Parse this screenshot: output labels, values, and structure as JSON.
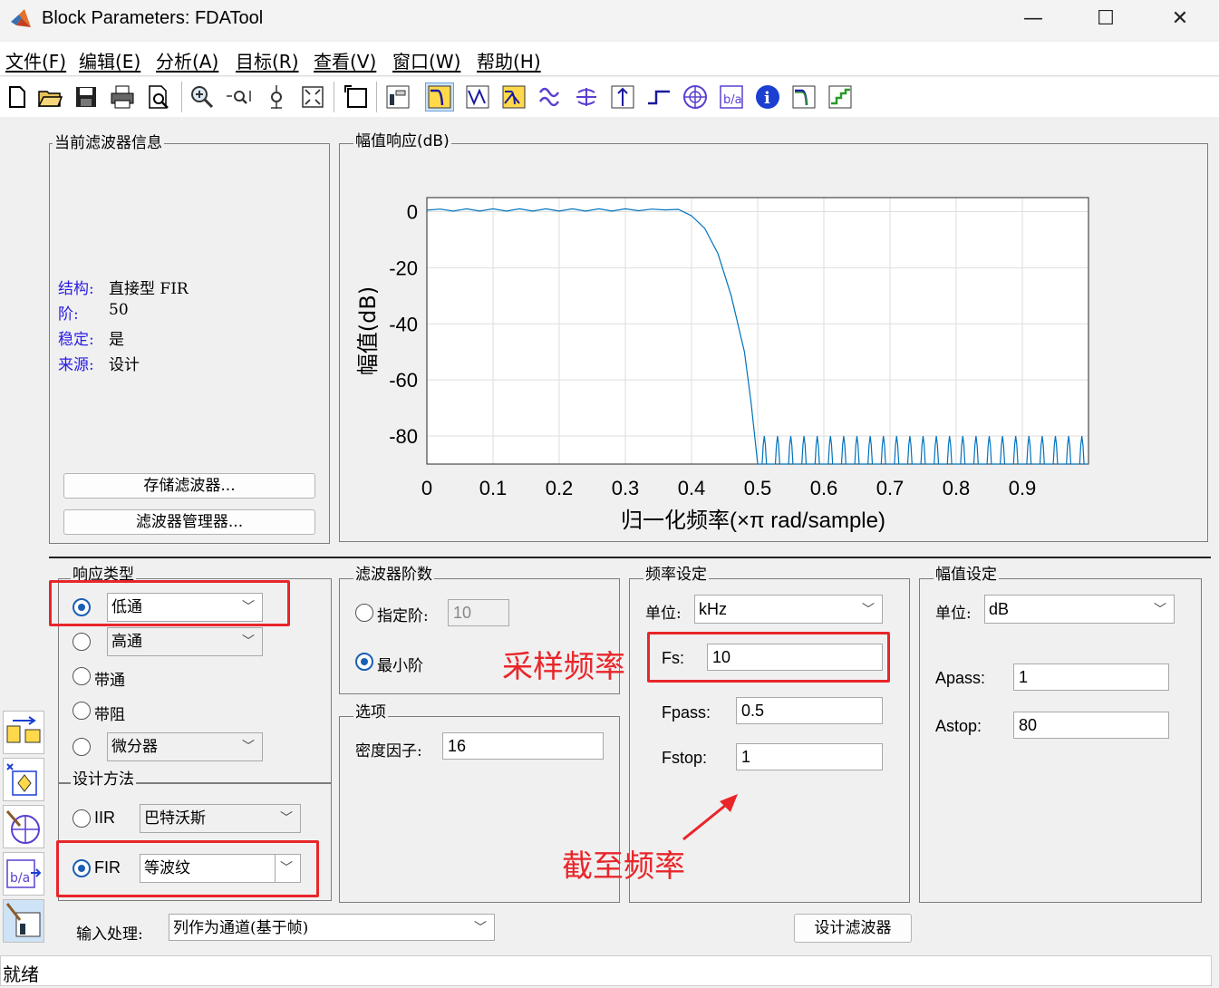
{
  "window": {
    "title": "Block Parameters: FDATool",
    "controls": {
      "minimize": "—",
      "maximize": "☐",
      "close": "✕"
    }
  },
  "menu": [
    "文件(F)",
    "编辑(E)",
    "分析(A)",
    "目标(R)",
    "查看(V)",
    "窗口(W)",
    "帮助(H)"
  ],
  "toolbar_icons": [
    "new-file-icon",
    "open-folder-icon",
    "save-icon",
    "print-icon",
    "print-preview-icon",
    "zoom-in-icon",
    "zoom-x-icon",
    "zoom-y-icon",
    "full-view-icon",
    "new-figure-icon",
    "filter-specs-icon",
    "magnitude-response-icon",
    "phase-response-icon",
    "magnitude-phase-icon",
    "group-delay-icon",
    "phase-delay-icon",
    "impulse-response-icon",
    "step-response-icon",
    "pole-zero-icon",
    "coefficients-icon",
    "info-icon",
    "magnitude-estimate-icon",
    "noise-power-icon"
  ],
  "filter_info": {
    "title": "当前滤波器信息",
    "rows": [
      {
        "label": "结构:",
        "value": "直接型 FIR"
      },
      {
        "label": "阶:",
        "value": "50"
      },
      {
        "label": "稳定:",
        "value": "是"
      },
      {
        "label": "来源:",
        "value": "设计"
      }
    ],
    "store_button": "存储滤波器...",
    "manager_button": "滤波器管理器..."
  },
  "plot": {
    "panel_title": "幅值响应(dB)",
    "chart_data": {
      "type": "line",
      "xlabel": "归一化频率(×π rad/sample)",
      "ylabel": "幅值(dB)",
      "xlim": [
        0,
        1
      ],
      "ylim": [
        -95,
        5
      ],
      "xticks": [
        0,
        0.1,
        0.2,
        0.3,
        0.4,
        0.5,
        0.6,
        0.7,
        0.8,
        0.9
      ],
      "yticks": [
        0,
        -20,
        -40,
        -60,
        -80
      ],
      "xtick_labels": [
        "0",
        "0.1",
        "0.2",
        "0.3",
        "0.4",
        "0.5",
        "0.6",
        "0.7",
        "0.8",
        "0.9"
      ],
      "ytick_labels": [
        "0",
        "-20",
        "-40",
        "-60",
        "-80"
      ],
      "grid": true,
      "color": "#0072bd",
      "series": [
        {
          "x": [
            0,
            0.02,
            0.04,
            0.06,
            0.08,
            0.1,
            0.12,
            0.14,
            0.16,
            0.18,
            0.2,
            0.22,
            0.24,
            0.26,
            0.28,
            0.3,
            0.32,
            0.34,
            0.36,
            0.38,
            0.4,
            0.42,
            0.44,
            0.46,
            0.48,
            0.49,
            0.5
          ],
          "y": [
            0.5,
            0.9,
            0.2,
            1.0,
            0.2,
            1.0,
            0.2,
            1.0,
            0.2,
            1.0,
            0.2,
            1.0,
            0.2,
            1.0,
            0.2,
            1.0,
            0.3,
            0.9,
            0.6,
            0.8,
            -1.5,
            -6,
            -15,
            -30,
            -50,
            -68,
            -95
          ]
        },
        {
          "stopband_peak_db": -80,
          "stopband_start": 0.5,
          "stopband_lobes": 25
        }
      ]
    }
  },
  "response_type": {
    "title": "响应类型",
    "options": [
      {
        "label": "低通",
        "combo": true,
        "selected": true
      },
      {
        "label": "高通",
        "combo": true,
        "selected": false
      },
      {
        "label": "带通",
        "combo": false,
        "selected": false
      },
      {
        "label": "带阻",
        "combo": false,
        "selected": false
      },
      {
        "label": "微分器",
        "combo": true,
        "selected": false
      }
    ]
  },
  "design_method": {
    "title": "设计方法",
    "iir_label": "IIR",
    "iir_value": "巴特沃斯",
    "fir_label": "FIR",
    "fir_value": "等波纹",
    "selected": "FIR"
  },
  "filter_order": {
    "title": "滤波器阶数",
    "specify_label": "指定阶:",
    "specify_value": "10",
    "minimum_label": "最小阶",
    "selected": "minimum"
  },
  "options": {
    "title": "选项",
    "density_label": "密度因子:",
    "density_value": "16"
  },
  "freq_spec": {
    "title": "频率设定",
    "unit_label": "单位:",
    "unit_value": "kHz",
    "fs_label": "Fs:",
    "fs_value": "10",
    "fpass_label": "Fpass:",
    "fpass_value": "0.5",
    "fstop_label": "Fstop:",
    "fstop_value": "1"
  },
  "mag_spec": {
    "title": "幅值设定",
    "unit_label": "单位:",
    "unit_value": "dB",
    "apass_label": "Apass:",
    "apass_value": "1",
    "astop_label": "Astop:",
    "astop_value": "80"
  },
  "input_processing": {
    "label": "输入处理:",
    "value": "列作为通道(基于帧)"
  },
  "design_button": "设计滤波器",
  "annotations": {
    "sampling_freq": "采样频率",
    "cutoff_freq": "截至频率",
    "color": "#e8262a"
  },
  "status": "就绪",
  "side_icons": [
    "transform-filter-icon",
    "create-multirate-icon",
    "pole-zero-editor-icon",
    "import-filter-icon",
    "design-filter-icon"
  ]
}
